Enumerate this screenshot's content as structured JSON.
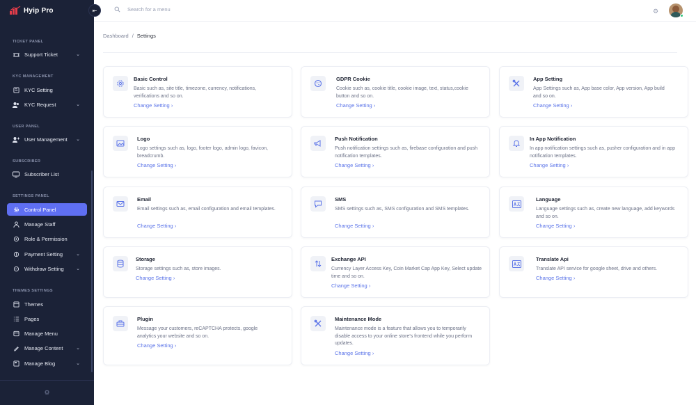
{
  "app": {
    "logo_text": "Hyip Pro"
  },
  "search": {
    "placeholder": "Search for a menu"
  },
  "breadcrumb": {
    "home": "Dashboard",
    "separator": "/",
    "current": "Settings"
  },
  "sidebar": {
    "sections": [
      {
        "title": "TICKET PANEL"
      },
      {
        "title": "KYC MANAGEMENT"
      },
      {
        "title": "USER PANEL"
      },
      {
        "title": "SUBSCRIBER"
      },
      {
        "title": "SETTINGS PANEL"
      },
      {
        "title": "THEMES SETTINGS"
      }
    ],
    "items": [
      {
        "label": "Support Ticket",
        "icon": "ticket-icon",
        "chevron": true
      },
      {
        "label": "KYC Setting",
        "icon": "kyc-setting-icon",
        "chevron": false
      },
      {
        "label": "KYC Request",
        "icon": "users-icon",
        "chevron": true
      },
      {
        "label": "User Management",
        "icon": "user-management-icon",
        "chevron": true
      },
      {
        "label": "Subscriber List",
        "icon": "subscriber-icon",
        "chevron": false
      },
      {
        "label": "Control Panel",
        "icon": "gear-icon",
        "chevron": false,
        "active": true
      },
      {
        "label": "Manage Staff",
        "icon": "staff-icon",
        "chevron": false
      },
      {
        "label": "Role & Permission",
        "icon": "role-icon",
        "chevron": false
      },
      {
        "label": "Payment Setting",
        "icon": "payment-icon",
        "chevron": true
      },
      {
        "label": "Withdraw Setting",
        "icon": "withdraw-icon",
        "chevron": true
      },
      {
        "label": "Themes",
        "icon": "themes-icon",
        "chevron": false
      },
      {
        "label": "Pages",
        "icon": "pages-icon",
        "chevron": false
      },
      {
        "label": "Manage Menu",
        "icon": "menu-icon",
        "chevron": false
      },
      {
        "label": "Manage Content",
        "icon": "content-icon",
        "chevron": true
      },
      {
        "label": "Manage Blog",
        "icon": "blog-icon",
        "chevron": true
      }
    ]
  },
  "cards": [
    {
      "title": "Basic Control",
      "desc": "Basic such as, site title, timezone, currency, notifications, verifications and so on.",
      "link": "Change Setting",
      "icon": "gear-icon"
    },
    {
      "title": "GDPR Cookie",
      "desc": "Cookie such as, cookie title, cookie image, text, status,cookie button and so on.",
      "link": "Change Setting",
      "icon": "cookie-icon"
    },
    {
      "title": "App Setting",
      "desc": "App Settings such as, App base color, App version, App build and so on.",
      "link": "Change Setting",
      "icon": "tools-icon"
    },
    {
      "title": "Logo",
      "desc": "Logo settings such as, logo, footer logo, admin logo, favicon, breadcrumb.",
      "link": "Change Setting",
      "icon": "image-icon"
    },
    {
      "title": "Push Notification",
      "desc": "Push notification settings such as, firebase configuration and push notification templates.",
      "link": "Change Setting",
      "icon": "megaphone-icon"
    },
    {
      "title": "In App Notification",
      "desc": "In app notification settings such as, pusher configuration and in app notification templates.",
      "link": "Change Setting",
      "icon": "bell-icon"
    },
    {
      "title": "Email",
      "desc": "Email settings such as, email configuration and email templates.",
      "link": "Change Setting",
      "icon": "mail-icon"
    },
    {
      "title": "SMS",
      "desc": "SMS settings such as, SMS configuration and SMS templates.",
      "link": "Change Setting",
      "icon": "chat-icon"
    },
    {
      "title": "Language",
      "desc": "Language settings such as, create new language, add keywords and so on.",
      "link": "Change Setting",
      "icon": "translate-icon"
    },
    {
      "title": "Storage",
      "desc": "Storage settings such as, store images.",
      "link": "Change Setting",
      "icon": "database-icon"
    },
    {
      "title": "Exchange API",
      "desc": "Currency Layer Access Key, Coin Market Cap App Key, Select update time and so on.",
      "link": "Change Setting",
      "icon": "exchange-icon"
    },
    {
      "title": "Translate Api",
      "desc": "Translate API service for google sheet, drive and others.",
      "link": "Change Setting",
      "icon": "translate-icon"
    },
    {
      "title": "Plugin",
      "desc": "Message your customers, reCAPTCHA protects, google analytics your website and so on.",
      "link": "Change Setting",
      "icon": "plugin-icon"
    },
    {
      "title": "Maintenance Mode",
      "desc": "Maintenance mode is a feature that allows you to temporarily disable access to your online store's frontend while you perform updates.",
      "link": "Change Setting",
      "icon": "tools-icon"
    }
  ],
  "colors": {
    "sidebar_bg": "#1b2237",
    "accent": "#5f6ff2",
    "link": "#5a73e8"
  }
}
